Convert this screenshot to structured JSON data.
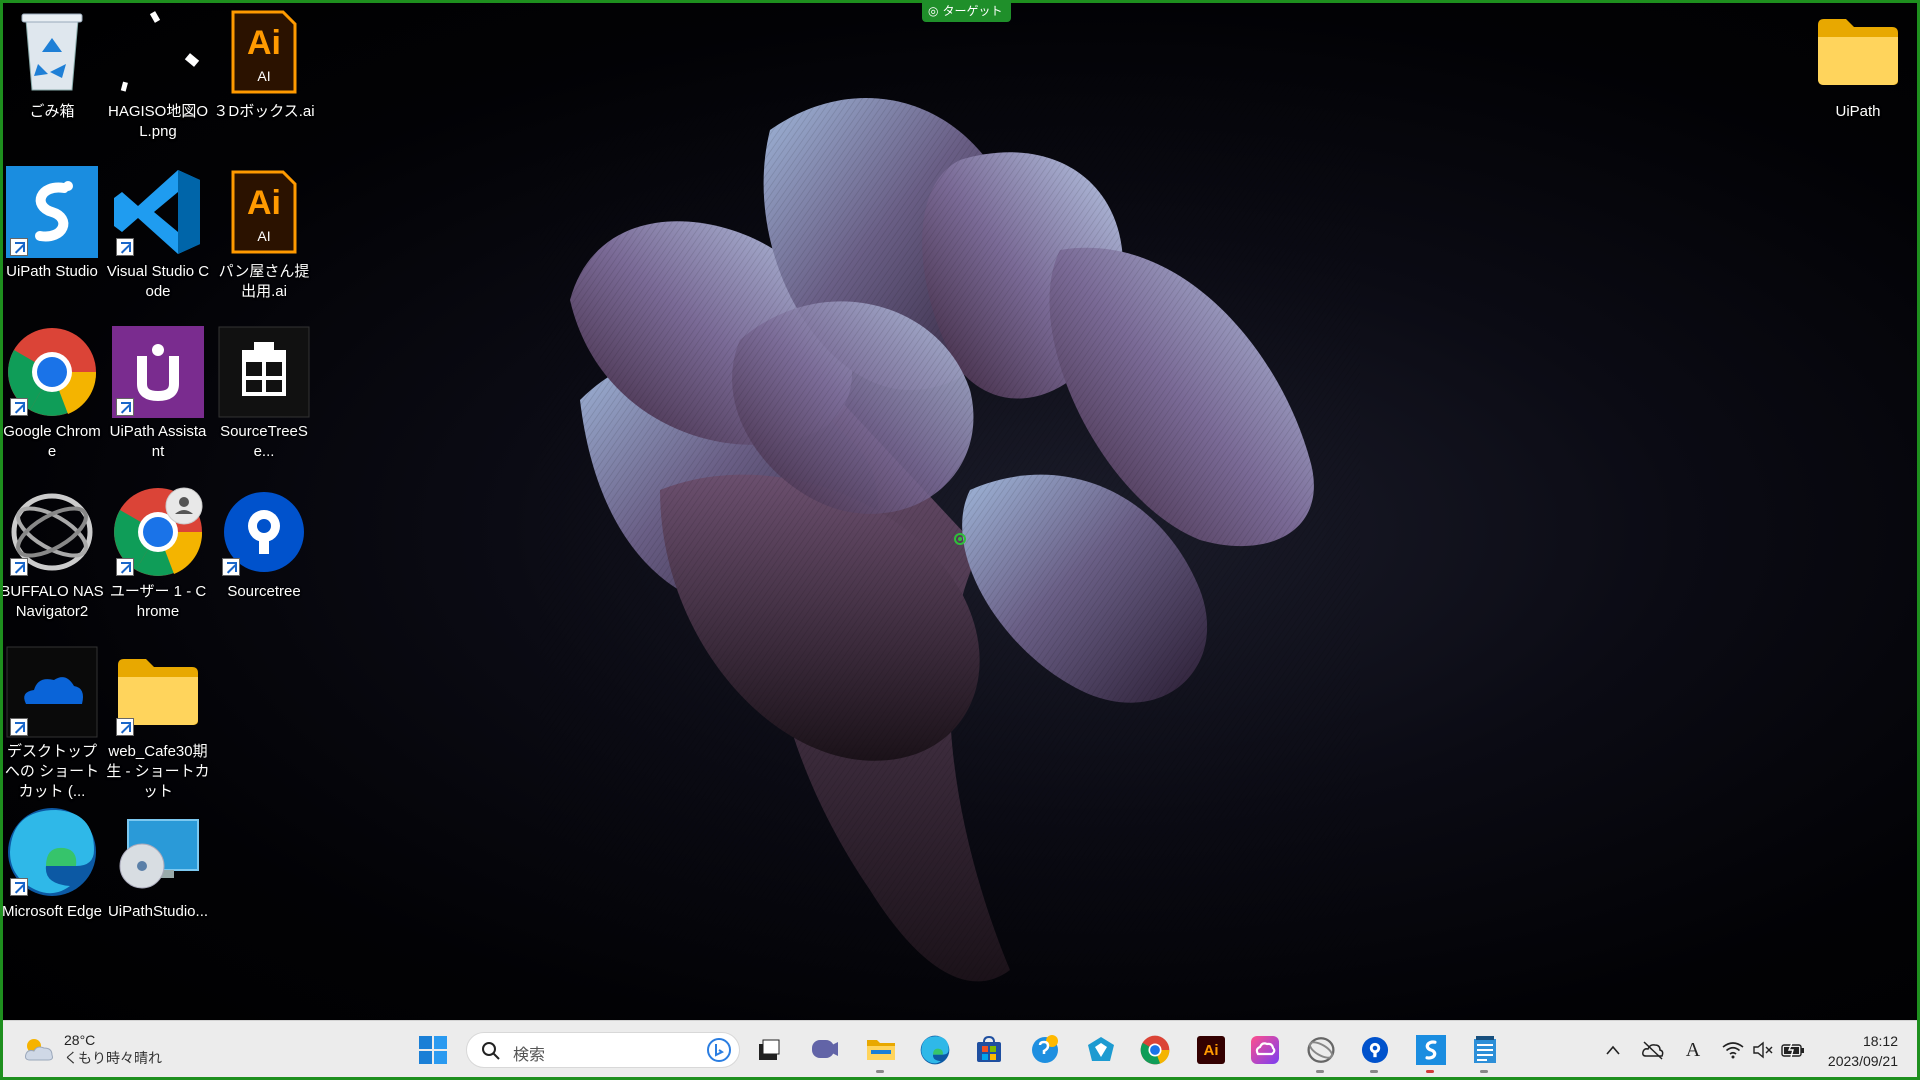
{
  "target_badge": "ターゲット",
  "desktop": {
    "icons": [
      {
        "id": "recycle",
        "label": "ごみ箱"
      },
      {
        "id": "hagiso",
        "label": "HAGISO地図OL.png"
      },
      {
        "id": "box3d",
        "label": "３Dボックス.ai"
      },
      {
        "id": "uipath-folder",
        "label": "UiPath"
      },
      {
        "id": "uipath-studio",
        "label": "UiPath Studio"
      },
      {
        "id": "vscode",
        "label": "Visual Studio Code"
      },
      {
        "id": "panya",
        "label": "パン屋さん提出用.ai"
      },
      {
        "id": "chrome",
        "label": "Google Chrome"
      },
      {
        "id": "uipath-assistant",
        "label": "UiPath Assistant"
      },
      {
        "id": "sourcetree-se",
        "label": "SourceTreeSe..."
      },
      {
        "id": "buffalo",
        "label": "BUFFALO NAS Navigator2"
      },
      {
        "id": "user1-chrome",
        "label": "ユーザー 1 - Chrome"
      },
      {
        "id": "sourcetree",
        "label": "Sourcetree"
      },
      {
        "id": "onedrive",
        "label": "デスクトップ への ショートカット (..."
      },
      {
        "id": "webcafe",
        "label": "web_Cafe30期生 - ショートカット"
      },
      {
        "id": "edge",
        "label": "Microsoft Edge"
      },
      {
        "id": "uipathstudio-setup",
        "label": "UiPathStudio..."
      }
    ],
    "ai_text": "Ai",
    "ai_sub": "AI"
  },
  "taskbar": {
    "weather_temp": "28°C",
    "weather_desc": "くもり時々晴れ",
    "search_placeholder": "検索",
    "apps": [
      "task-view",
      "teams",
      "file-explorer",
      "edge",
      "store",
      "weather-app",
      "hammer-app",
      "chrome",
      "illustrator",
      "creative-cloud",
      "buffalo",
      "sourcetree",
      "uipath-studio",
      "notepad"
    ],
    "clock_time": "18:12",
    "clock_date": "2023/09/21",
    "ime": "A"
  }
}
